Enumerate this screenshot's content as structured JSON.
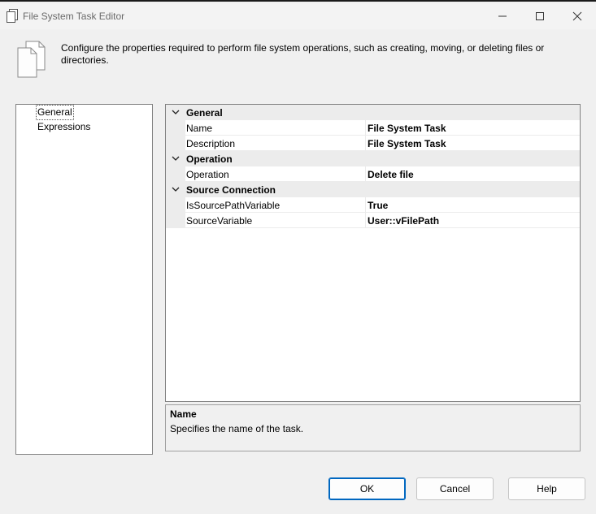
{
  "window": {
    "title": "File System Task Editor",
    "icon": "document-pages-icon",
    "controls": [
      "minimize-icon",
      "maximize-icon",
      "close-icon"
    ]
  },
  "header": {
    "icon": "document-pages-icon",
    "description": "Configure the properties required to perform file system operations, such as creating, moving, or deleting files or directories."
  },
  "nav": {
    "items": [
      {
        "label": "General",
        "selected": true
      },
      {
        "label": "Expressions",
        "selected": false
      }
    ]
  },
  "grid": {
    "categories": [
      {
        "label": "General",
        "properties": [
          {
            "name": "Name",
            "value": "File System Task"
          },
          {
            "name": "Description",
            "value": "File System Task"
          }
        ]
      },
      {
        "label": "Operation",
        "properties": [
          {
            "name": "Operation",
            "value": "Delete file"
          }
        ]
      },
      {
        "label": "Source Connection",
        "properties": [
          {
            "name": "IsSourcePathVariable",
            "value": "True"
          },
          {
            "name": "SourceVariable",
            "value": "User::vFilePath"
          }
        ]
      }
    ]
  },
  "description_pane": {
    "title": "Name",
    "text": "Specifies the name of the task."
  },
  "buttons": {
    "ok": "OK",
    "cancel": "Cancel",
    "help": "Help"
  },
  "colors": {
    "accent": "#0067c0",
    "panel": "#f0f0f0",
    "category_bg": "#ececec"
  }
}
